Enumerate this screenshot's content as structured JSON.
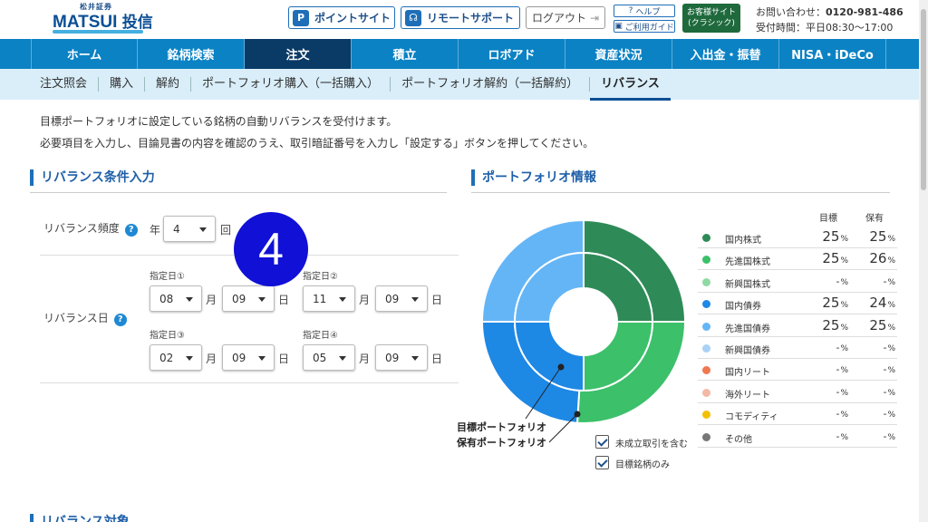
{
  "header": {
    "logo_top": "松井証券",
    "logo_main": "MATSUI",
    "logo_sub": "投信",
    "point_site": "ポイントサイト",
    "remote_support": "リモートサポート",
    "logout": "ログアウト",
    "help": "ヘルプ",
    "guide": "ご利用ガイド",
    "classic_line1": "お客様サイト",
    "classic_line2": "(クラシック)",
    "contact_label": "お問い合わせ：",
    "contact_phone": "0120-981-486",
    "hours": "受付時間：平日08:30～17:00"
  },
  "nav": [
    "ホーム",
    "銘柄検索",
    "注文",
    "積立",
    "ロボアド",
    "資産状況",
    "入出金・振替",
    "NISA・iDeCo"
  ],
  "subnav": [
    "注文照会",
    "購入",
    "解約",
    "ポートフォリオ購入（一括購入）",
    "ポートフォリオ解約（一括解約）",
    "リバランス"
  ],
  "intro": {
    "line1": "目標ポートフォリオに設定している銘柄の自動リバランスを受付けます。",
    "line2": "必要項目を入力し、目論見書の内容を確認のうえ、取引暗証番号を入力し「設定する」ボタンを押してください。"
  },
  "conditions": {
    "title": "リバランス条件入力",
    "freq_label": "リバランス頻度",
    "freq_prefix": "年",
    "freq_value": "4",
    "freq_suffix": "回",
    "date_label": "リバランス日",
    "month_unit": "月",
    "day_unit": "日",
    "dates": [
      {
        "label": "指定日①",
        "month": "08",
        "day": "09"
      },
      {
        "label": "指定日②",
        "month": "11",
        "day": "09"
      },
      {
        "label": "指定日③",
        "month": "02",
        "day": "09"
      },
      {
        "label": "指定日④",
        "month": "05",
        "day": "09"
      }
    ]
  },
  "badge": "4",
  "portfolio": {
    "title": "ポートフォリオ情報",
    "col_target": "目標",
    "col_hold": "保有",
    "caption_target": "目標ポートフォリオ",
    "caption_hold": "保有ポートフォリオ",
    "check_pending": "未成立取引を含む",
    "check_target_only": "目標銘柄のみ",
    "items": [
      {
        "name": "国内株式",
        "color": "#2e8b57",
        "target": "25",
        "hold": "25"
      },
      {
        "name": "先進国株式",
        "color": "#3cc06a",
        "target": "25",
        "hold": "26"
      },
      {
        "name": "新興国株式",
        "color": "#8fdaa4",
        "target": "-",
        "hold": "-"
      },
      {
        "name": "国内債券",
        "color": "#1e88e5",
        "target": "25",
        "hold": "24"
      },
      {
        "name": "先進国債券",
        "color": "#64b5f6",
        "target": "25",
        "hold": "25"
      },
      {
        "name": "新興国債券",
        "color": "#a9d2f5",
        "target": "-",
        "hold": "-"
      },
      {
        "name": "国内リート",
        "color": "#f07850",
        "target": "-",
        "hold": "-"
      },
      {
        "name": "海外リート",
        "color": "#f4b8a6",
        "target": "-",
        "hold": "-"
      },
      {
        "name": "コモディティ",
        "color": "#f2c100",
        "target": "-",
        "hold": "-"
      },
      {
        "name": "その他",
        "color": "#777777",
        "target": "-",
        "hold": "-"
      }
    ],
    "percent": "%"
  },
  "next_section": "リバランス対象"
}
